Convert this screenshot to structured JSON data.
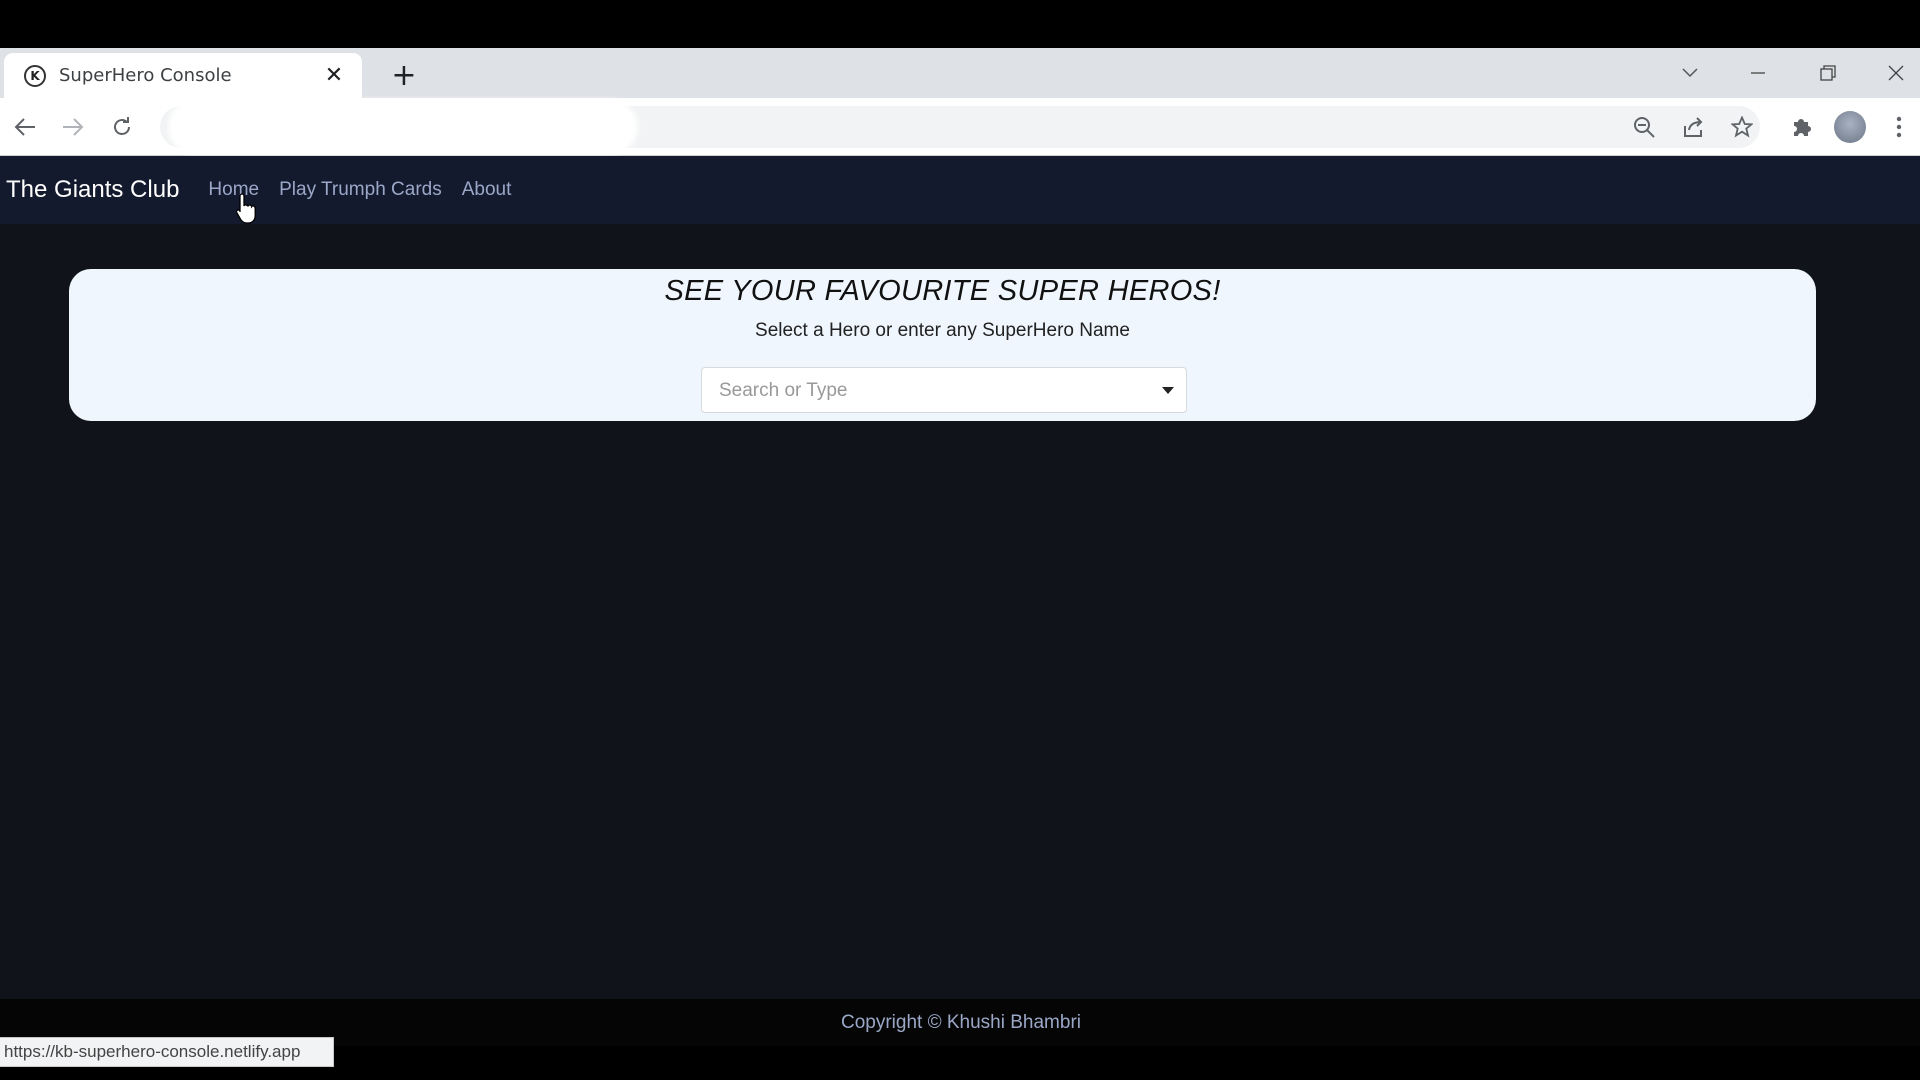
{
  "browser": {
    "tab_title": "SuperHero Console",
    "tab_favicon_letter": "K",
    "tab_close_glyph": "✕",
    "new_tab_glyph": "+",
    "omnibox_text": "",
    "status_url": "https://kb-superhero-console.netlify.app",
    "icons": {
      "back": "back-arrow-icon",
      "forward": "forward-arrow-icon",
      "reload": "reload-icon",
      "zoom": "zoom-out-icon",
      "share": "share-icon",
      "bookmark": "star-icon",
      "extensions": "puzzle-icon",
      "menu": "kebab-menu-icon"
    }
  },
  "navbar": {
    "brand": "The Giants Club",
    "links": [
      {
        "label": "Home"
      },
      {
        "label": "Play Trumph Cards"
      },
      {
        "label": "About"
      }
    ]
  },
  "hero": {
    "title": "SEE YOUR FAVOURITE SUPER HEROS!",
    "subtitle": "Select a Hero or enter any SuperHero Name",
    "select_placeholder": "Search or Type"
  },
  "footer": {
    "copyright": "Copyright © Khushi Bhambri"
  },
  "colors": {
    "navbar_bg": "#141a2e",
    "page_bg": "#11131a",
    "card_bg": "#eff6fe",
    "link": "#9aa7c7"
  }
}
